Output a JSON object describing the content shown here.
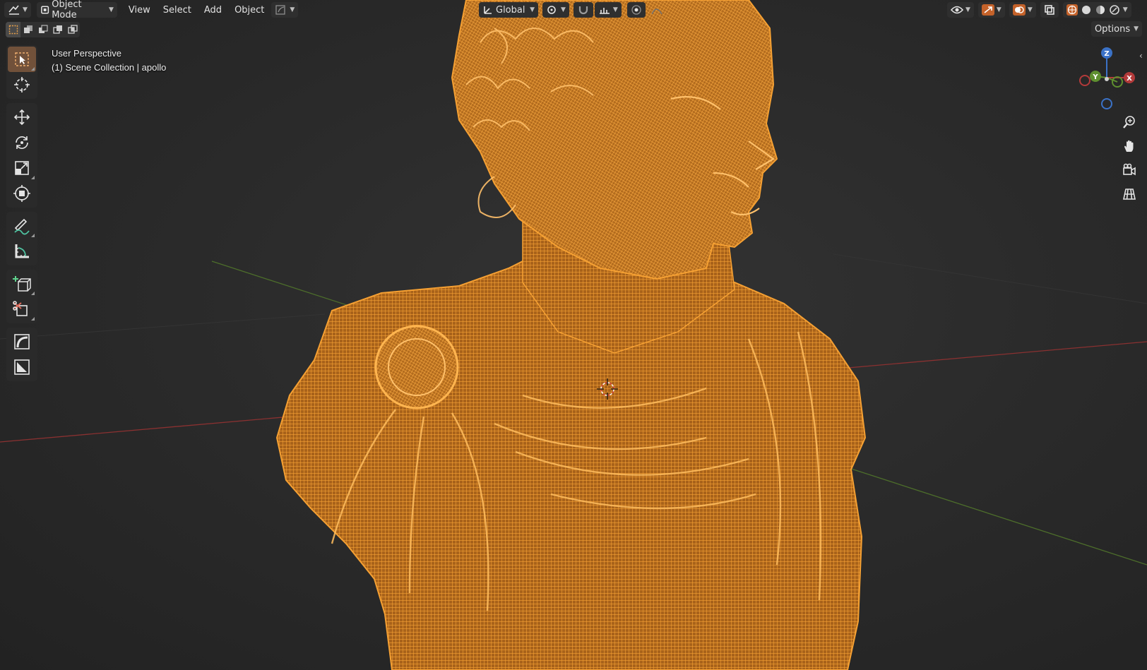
{
  "header": {
    "mode": "Object Mode",
    "menus": [
      "View",
      "Select",
      "Add",
      "Object"
    ],
    "orientation": "Global",
    "options_label": "Options"
  },
  "viewport": {
    "perspective": "User Perspective",
    "collection": "(1) Scene Collection | apollo"
  },
  "navigator": {
    "axis_z": "Z",
    "axis_y": "Y",
    "axis_x": "X"
  },
  "colors": {
    "mesh_wire": "#f29a2e",
    "mesh_fill": "#9a5a14",
    "axis_x": "#b33a3a",
    "axis_y": "#5e8f2f",
    "axis_z": "#3b72c7",
    "active_tool": "#71513a"
  },
  "toolbar": {
    "tools": [
      "select-box",
      "cursor",
      "move",
      "rotate",
      "scale",
      "transform",
      "annotate",
      "measure",
      "add-cube",
      "extrude",
      "curve",
      "image"
    ]
  }
}
